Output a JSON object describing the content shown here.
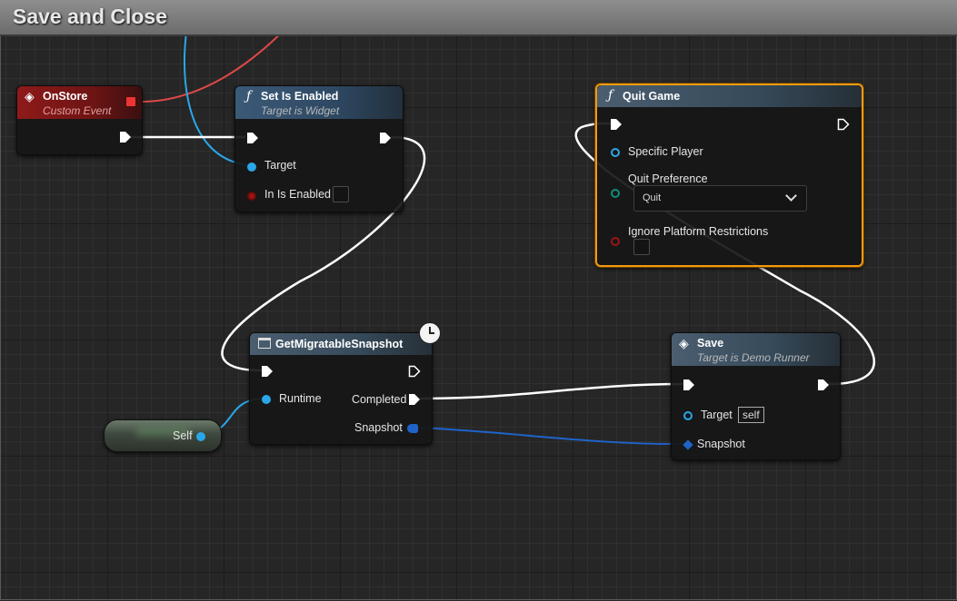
{
  "graph": {
    "title": "Save and Close"
  },
  "nodes": {
    "on_store": {
      "title": "OnStore",
      "subtitle": "Custom Event"
    },
    "set_is_enabled": {
      "title": "Set Is Enabled",
      "subtitle": "Target is Widget",
      "target_label": "Target",
      "in_is_enabled_label": "In Is Enabled"
    },
    "quit_game": {
      "title": "Quit Game",
      "specific_player_label": "Specific Player",
      "quit_preference_label": "Quit Preference",
      "quit_preference_value": "Quit",
      "ignore_platform_label": "Ignore Platform Restrictions"
    },
    "get_migratable_snapshot": {
      "title": "GetMigratableSnapshot",
      "runtime_label": "Runtime",
      "completed_label": "Completed",
      "snapshot_label": "Snapshot"
    },
    "save": {
      "title": "Save",
      "subtitle": "Target is Demo Runner",
      "target_label": "Target",
      "target_default": "self",
      "snapshot_label": "Snapshot"
    },
    "self_ref": {
      "label": "Self"
    }
  },
  "colors": {
    "exec_wire": "#ffffff",
    "object_wire": "#2aa7e8",
    "struct_wire": "#1f63c9",
    "event_wire": "#e04848",
    "selection": "#f09a12",
    "event_header": "#8e1a1a",
    "function_header": "#3b5a78"
  }
}
